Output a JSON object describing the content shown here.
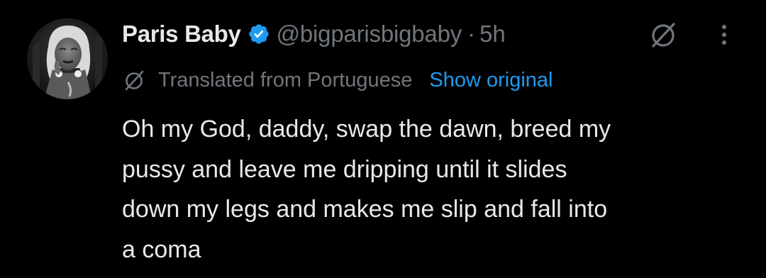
{
  "author": {
    "display_name": "Paris Baby",
    "handle": "@bigparisbigbaby",
    "separator": "·",
    "timestamp": "5h",
    "verified": true,
    "avatar_icon": "profile-photo"
  },
  "translation": {
    "label": "Translated from Portuguese",
    "show_original_label": "Show original",
    "icon": "translate-icon"
  },
  "actions": {
    "translate_icon": "translate-icon",
    "more_icon": "more-vertical-icon"
  },
  "tweet": {
    "text": "Oh my God, daddy, swap the dawn, breed my\npussy and leave me dripping until it slides\ndown my legs and makes me slip and fall into\na coma"
  },
  "colors": {
    "background": "#000000",
    "primary_text": "#e7e9ea",
    "secondary_text": "#71767b",
    "link": "#1d9bf0",
    "verified_badge": "#1d9bf0"
  }
}
